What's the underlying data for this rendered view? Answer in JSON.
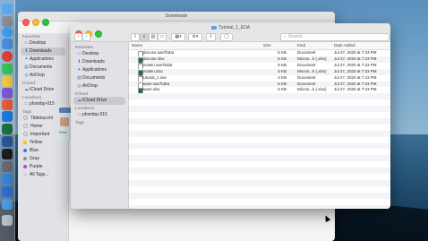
{
  "dock": {
    "icons": [
      "finder-icon",
      "launchpad-icon",
      "safari-icon",
      "mail-icon",
      "chrome-icon",
      "messages-icon",
      "maps-icon",
      "photos-icon",
      "facetime-icon",
      "calendar-icon",
      "contacts-icon",
      "notes-icon",
      "itunes-icon",
      "podcasts-icon",
      "appstore-icon",
      "settings-icon",
      "excel-icon",
      "word-icon",
      "powerpoint-icon",
      "terminal-icon",
      "rstudio-icon",
      "trash-icon"
    ]
  },
  "back_window": {
    "title": "Downloads",
    "sidebar": {
      "favorites_head": "Favorites",
      "favorites": [
        {
          "label": "Desktop",
          "icon": "desktop-icon"
        },
        {
          "label": "Downloads",
          "icon": "downloads-icon"
        },
        {
          "label": "Applications",
          "icon": "applications-icon"
        },
        {
          "label": "Documents",
          "icon": "documents-icon"
        },
        {
          "label": "AirDrop",
          "icon": "airdrop-icon"
        }
      ],
      "icloud_head": "iCloud",
      "icloud": [
        {
          "label": "iCloud Drive",
          "icon": "cloud-icon"
        }
      ],
      "locations_head": "Locations",
      "locations": [
        {
          "label": "phsmbp-015",
          "icon": "computer-icon"
        }
      ],
      "tags_head": "Tags",
      "tags": [
        {
          "label": "Tibbinacchi",
          "color": "#ffffff"
        },
        {
          "label": "Home",
          "color": "#ffffff"
        },
        {
          "label": "Important",
          "color": "#ffffff"
        },
        {
          "label": "Yellow",
          "color": "#f5c400"
        },
        {
          "label": "Blue",
          "color": "#3478f6"
        },
        {
          "label": "Gray",
          "color": "#8e8e93"
        },
        {
          "label": "Purple",
          "color": "#a550c8"
        },
        {
          "label": "All Tags...",
          "color": "#cfcfcf"
        }
      ]
    },
    "peek_label": "Pers"
  },
  "front_window": {
    "title": "Tutorial_1_EDA",
    "search_placeholder": "Search",
    "sidebar": {
      "favorites_head": "Favorites",
      "favorites": [
        {
          "label": "Desktop",
          "icon": "desktop-icon"
        },
        {
          "label": "Downloads",
          "icon": "downloads-icon"
        },
        {
          "label": "Applications",
          "icon": "applications-icon"
        },
        {
          "label": "Documents",
          "icon": "documents-icon"
        },
        {
          "label": "AirDrop",
          "icon": "airdrop-icon"
        }
      ],
      "icloud_head": "iCloud",
      "icloud": [
        {
          "label": "iCloud Drive",
          "icon": "cloud-icon"
        }
      ],
      "locations_head": "Locations",
      "locations": [
        {
          "label": "phsmbp-015",
          "icon": "computer-icon"
        }
      ],
      "tags_head": "Tags"
    },
    "columns": {
      "name": "Name",
      "size": "Size",
      "kind": "Kind",
      "date": "Date Added"
    },
    "files": [
      {
        "name": "glucose.sas7bdat",
        "size": "5 KB",
        "kind": "Document",
        "date": "Jul 27, 2020 at 7:23 PM",
        "icon": "document-icon",
        "color": "#ffffff"
      },
      {
        "name": "glucose.xlsx",
        "size": "5 KB",
        "kind": "Micros...k (.xlsx)",
        "date": "Jul 27, 2020 at 7:23 PM",
        "icon": "excel-file-icon",
        "color": "#1e7145"
      },
      {
        "name": "protein.sas7bdat",
        "size": "5 KB",
        "kind": "Document",
        "date": "Jul 27, 2020 at 7:23 PM",
        "icon": "document-icon",
        "color": "#ffffff"
      },
      {
        "name": "protein.xlsx",
        "size": "5 KB",
        "kind": "Micros...k (.xlsx)",
        "date": "Jul 27, 2020 at 7:23 PM",
        "icon": "excel-file-icon",
        "color": "#1e7145"
      },
      {
        "name": "tutorial_1.sas",
        "size": "4 KB",
        "kind": "Document",
        "date": "Jul 27, 2020 at 7:23 PM",
        "icon": "document-icon",
        "color": "#ffffff"
      },
      {
        "name": "wave.sas7bdat",
        "size": "5 KB",
        "kind": "Document",
        "date": "Jul 27, 2020 at 7:23 PM",
        "icon": "document-icon",
        "color": "#ffffff"
      },
      {
        "name": "wave.xlsx",
        "size": "5 KB",
        "kind": "Micros...k (.xlsx)",
        "date": "Jul 27, 2020 at 7:23 PM",
        "icon": "excel-file-icon",
        "color": "#1e7145"
      }
    ]
  }
}
